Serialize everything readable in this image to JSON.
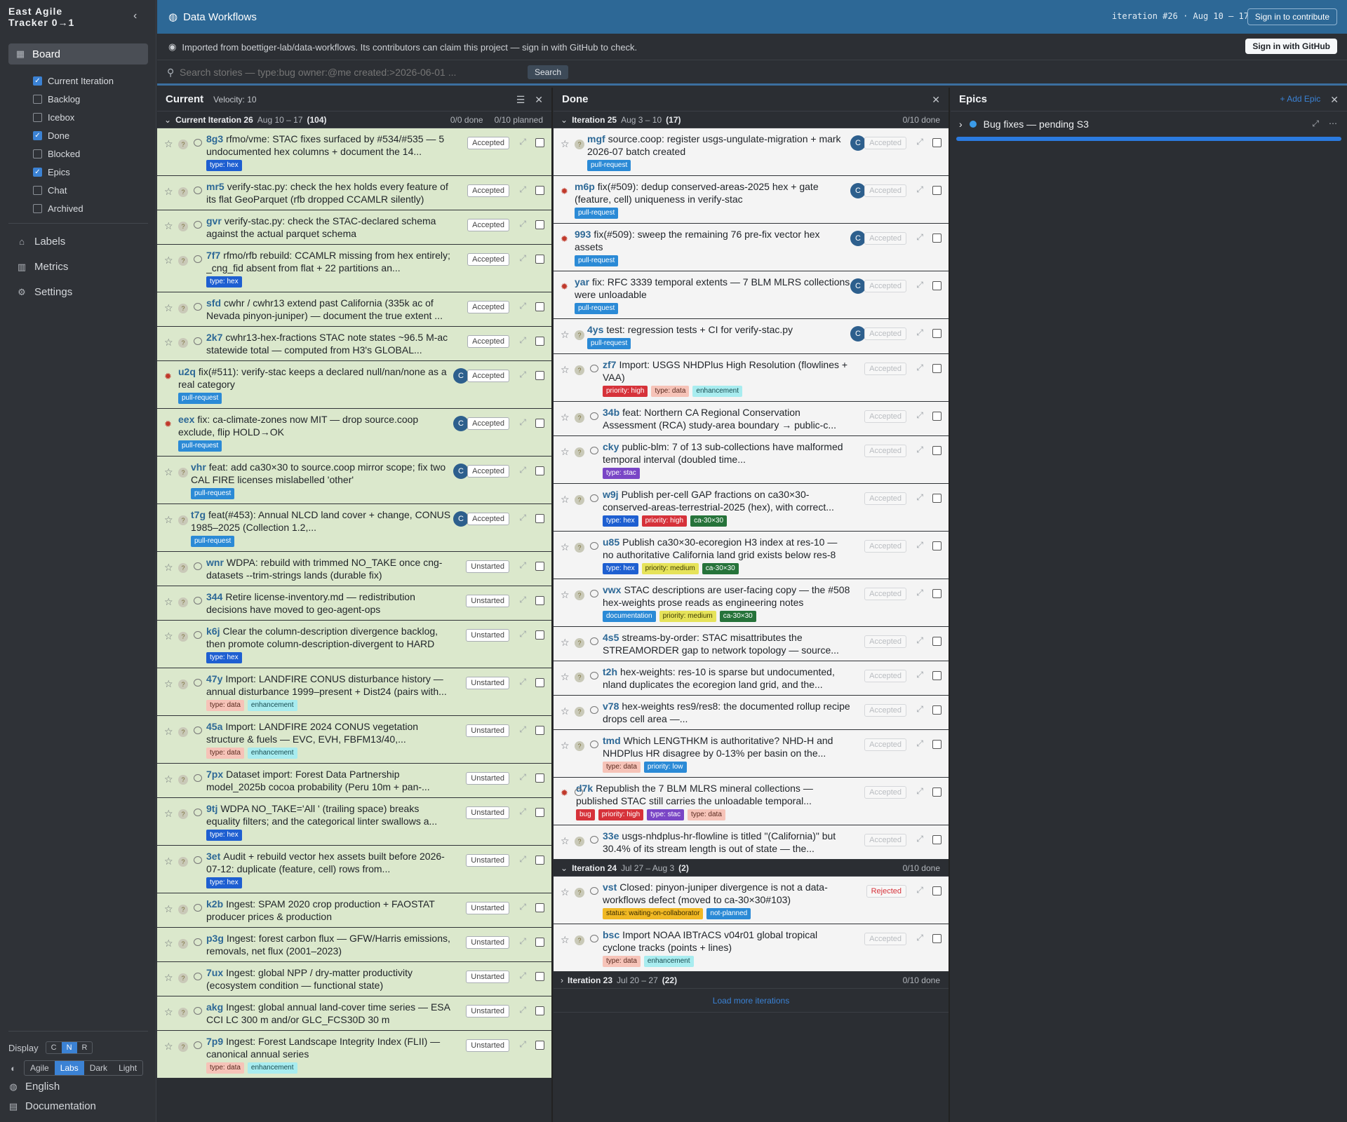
{
  "sidebar": {
    "brand_line1": "East Agile",
    "brand_line2": "Tracker 0→1",
    "board_label": "Board",
    "panels": [
      {
        "label": "Current Iteration",
        "checked": true
      },
      {
        "label": "Backlog",
        "checked": false
      },
      {
        "label": "Icebox",
        "checked": false
      },
      {
        "label": "Done",
        "checked": true
      },
      {
        "label": "Blocked",
        "checked": false
      },
      {
        "label": "Epics",
        "checked": true
      },
      {
        "label": "Chat",
        "checked": false
      },
      {
        "label": "Archived",
        "checked": false
      }
    ],
    "labels": "Labels",
    "metrics": "Metrics",
    "settings": "Settings",
    "display_label": "Display",
    "display_options": [
      "C",
      "N",
      "R"
    ],
    "theme_options": [
      "Agile",
      "Labs",
      "Dark",
      "Light"
    ],
    "language": "English",
    "documentation": "Documentation"
  },
  "header": {
    "title": "Data Workflows",
    "iteration_info": "iteration #26 · Aug 10 – 17",
    "sign_in": "Sign in to contribute"
  },
  "banner": {
    "message": "Imported from boettiger-lab/data-workflows. Its contributors can claim this project — sign in with GitHub to check.",
    "button": "Sign in with GitHub"
  },
  "search": {
    "placeholder": "Search stories — type:bug owner:@me created:>2026-06-01 ...",
    "button": "Search"
  },
  "current": {
    "title": "Current",
    "velocity": "Velocity: 10",
    "iteration": {
      "name": "Current Iteration 26",
      "dates": "Aug 10 – 17",
      "count": "(104)",
      "done": "0/0 done",
      "planned": "0/10 planned"
    },
    "stories": [
      {
        "id": "8g3",
        "text": "rfmo/vme: STAC fixes surfaced by #534/#535 — 5 undocumented hex columns + document the 14...",
        "labels": [
          [
            "type: hex",
            "hex"
          ]
        ],
        "state": "Accepted"
      },
      {
        "id": "mr5",
        "text": "verify-stac.py: check the hex holds every feature of its flat GeoParquet (rfb dropped CCAMLR silently)",
        "labels": [],
        "state": "Accepted"
      },
      {
        "id": "gvr",
        "text": "verify-stac.py: check the STAC-declared schema against the actual parquet schema",
        "labels": [],
        "state": "Accepted"
      },
      {
        "id": "7f7",
        "text": "rfmo/rfb rebuild: CCAMLR missing from hex entirely; _cng_fid absent from flat + 22 partitions an...",
        "labels": [
          [
            "type: hex",
            "hex"
          ]
        ],
        "state": "Accepted"
      },
      {
        "id": "sfd",
        "text": "cwhr / cwhr13 extend past California (335k ac of Nevada pinyon-juniper) — document the true extent ...",
        "labels": [],
        "state": "Accepted"
      },
      {
        "id": "2k7",
        "text": "cwhr13-hex-fractions STAC note states ~96.5 M-ac statewide total — computed from H3's GLOBAL...",
        "labels": [],
        "state": "Accepted"
      },
      {
        "id": "u2q",
        "text": "fix(#511): verify-stac keeps a declared null/nan/none as a real category",
        "labels": [
          [
            "pull-request",
            "pr"
          ]
        ],
        "state": "Accepted",
        "bug": true,
        "owner": "C"
      },
      {
        "id": "eex",
        "text": "fix: ca-climate-zones now MIT — drop source.coop exclude, flip HOLD→OK",
        "labels": [
          [
            "pull-request",
            "pr"
          ]
        ],
        "state": "Accepted",
        "bug": true,
        "owner": "C"
      },
      {
        "id": "vhr",
        "text": "feat: add ca30×30 to source.coop mirror scope; fix two CAL FIRE licenses mislabelled 'other'",
        "labels": [
          [
            "pull-request",
            "pr"
          ]
        ],
        "state": "Accepted",
        "owner": "C"
      },
      {
        "id": "t7g",
        "text": "feat(#453): Annual NLCD land cover + change, CONUS 1985–2025 (Collection 1.2,...",
        "labels": [
          [
            "pull-request",
            "pr"
          ]
        ],
        "state": "Accepted",
        "owner": "C"
      },
      {
        "id": "wnr",
        "text": "WDPA: rebuild with trimmed NO_TAKE once cng-datasets --trim-strings lands (durable fix)",
        "labels": [],
        "state": "Unstarted"
      },
      {
        "id": "344",
        "text": "Retire license-inventory.md — redistribution decisions have moved to geo-agent-ops",
        "labels": [],
        "state": "Unstarted"
      },
      {
        "id": "k6j",
        "text": "Clear the column-description divergence backlog, then promote column-description-divergent to HARD",
        "labels": [
          [
            "type: hex",
            "hex"
          ]
        ],
        "state": "Unstarted"
      },
      {
        "id": "47y",
        "text": "Import: LANDFIRE CONUS disturbance history — annual disturbance 1999–present + Dist24 (pairs with...",
        "labels": [
          [
            "type: data",
            "data"
          ],
          [
            "enhancement",
            "enh"
          ]
        ],
        "state": "Unstarted"
      },
      {
        "id": "45a",
        "text": "Import: LANDFIRE 2024 CONUS vegetation structure & fuels — EVC, EVH, FBFM13/40,...",
        "labels": [
          [
            "type: data",
            "data"
          ],
          [
            "enhancement",
            "enh"
          ]
        ],
        "state": "Unstarted"
      },
      {
        "id": "7px",
        "text": "Dataset import: Forest Data Partnership model_2025b cocoa probability (Peru 10m + pan-...",
        "labels": [],
        "state": "Unstarted"
      },
      {
        "id": "9tj",
        "text": "WDPA NO_TAKE='All ' (trailing space) breaks equality filters; and the categorical linter swallows a...",
        "labels": [
          [
            "type: hex",
            "hex"
          ]
        ],
        "state": "Unstarted"
      },
      {
        "id": "3et",
        "text": "Audit + rebuild vector hex assets built before 2026-07-12: duplicate (feature, cell) rows from...",
        "labels": [
          [
            "type: hex",
            "hex"
          ]
        ],
        "state": "Unstarted"
      },
      {
        "id": "k2b",
        "text": "Ingest: SPAM 2020 crop production + FAOSTAT producer prices & production",
        "labels": [],
        "state": "Unstarted"
      },
      {
        "id": "p3g",
        "text": "Ingest: forest carbon flux — GFW/Harris emissions, removals, net flux (2001–2023)",
        "labels": [],
        "state": "Unstarted"
      },
      {
        "id": "7ux",
        "text": "Ingest: global NPP / dry-matter productivity (ecosystem condition — functional state)",
        "labels": [],
        "state": "Unstarted"
      },
      {
        "id": "akg",
        "text": "Ingest: global annual land-cover time series — ESA CCI LC 300 m and/or GLC_FCS30D 30 m",
        "labels": [],
        "state": "Unstarted"
      },
      {
        "id": "7p9",
        "text": "Ingest: Forest Landscape Integrity Index (FLII) — canonical annual series",
        "labels": [
          [
            "type: data",
            "data"
          ],
          [
            "enhancement",
            "enh"
          ]
        ],
        "state": "Unstarted"
      }
    ]
  },
  "done": {
    "title": "Done",
    "iterations": [
      {
        "name": "Iteration 25",
        "dates": "Aug 3 – 10",
        "count": "(17)",
        "done": "0/10 done",
        "expanded": true,
        "stories": [
          {
            "id": "mgf",
            "text": "source.coop: register usgs-ungulate-migration + mark 2026-07 batch created",
            "labels": [
              [
                "pull-request",
                "pr"
              ]
            ],
            "state": "Accepted",
            "owner": "C"
          },
          {
            "id": "m6p",
            "text": "fix(#509): dedup conserved-areas-2025 hex + gate (feature, cell) uniqueness in verify-stac",
            "labels": [
              [
                "pull-request",
                "pr"
              ]
            ],
            "state": "Accepted",
            "owner": "C",
            "bug": true
          },
          {
            "id": "993",
            "text": "fix(#509): sweep the remaining 76 pre-fix vector hex assets",
            "labels": [
              [
                "pull-request",
                "pr"
              ]
            ],
            "state": "Accepted",
            "owner": "C",
            "bug": true
          },
          {
            "id": "yar",
            "text": "fix: RFC 3339 temporal extents — 7 BLM MLRS collections were unloadable",
            "labels": [
              [
                "pull-request",
                "pr"
              ]
            ],
            "state": "Accepted",
            "owner": "C",
            "bug": true
          },
          {
            "id": "4ys",
            "text": "test: regression tests + CI for verify-stac.py",
            "labels": [
              [
                "pull-request",
                "pr"
              ]
            ],
            "state": "Accepted",
            "owner": "C"
          },
          {
            "id": "zf7",
            "text": "Import: USGS NHDPlus High Resolution (flowlines + VAA)",
            "labels": [
              [
                "priority: high",
                "high"
              ],
              [
                "type: data",
                "data"
              ],
              [
                "enhancement",
                "enh"
              ]
            ],
            "state": "Accepted"
          },
          {
            "id": "34b",
            "text": "feat: Northern CA Regional Conservation Assessment (RCA) study-area boundary → public-c...",
            "labels": [],
            "state": "Accepted"
          },
          {
            "id": "cky",
            "text": "public-blm: 7 of 13 sub-collections have malformed temporal interval (doubled time...",
            "labels": [
              [
                "type: stac",
                "stac"
              ]
            ],
            "state": "Accepted"
          },
          {
            "id": "w9j",
            "text": "Publish per-cell GAP fractions on ca30×30-conserved-areas-terrestrial-2025 (hex), with correct...",
            "labels": [
              [
                "type: hex",
                "hex"
              ],
              [
                "priority: high",
                "high"
              ],
              [
                "ca-30×30",
                "ca"
              ]
            ],
            "state": "Accepted"
          },
          {
            "id": "u85",
            "text": "Publish ca30×30-ecoregion H3 index at res-10 — no authoritative California land grid exists below res-8",
            "labels": [
              [
                "type: hex",
                "hex"
              ],
              [
                "priority: medium",
                "med"
              ],
              [
                "ca-30×30",
                "ca"
              ]
            ],
            "state": "Accepted"
          },
          {
            "id": "vwx",
            "text": "STAC descriptions are user-facing copy — the #508 hex-weights prose reads as engineering notes",
            "labels": [
              [
                "documentation",
                "doc"
              ],
              [
                "priority: medium",
                "med"
              ],
              [
                "ca-30×30",
                "ca"
              ]
            ],
            "state": "Accepted"
          },
          {
            "id": "4s5",
            "text": "streams-by-order: STAC misattributes the STREAMORDER gap to network topology — source...",
            "labels": [],
            "state": "Accepted"
          },
          {
            "id": "t2h",
            "text": "hex-weights: res-10 is sparse but undocumented, nland duplicates the ecoregion land grid, and the...",
            "labels": [],
            "state": "Accepted"
          },
          {
            "id": "v78",
            "text": "hex-weights res9/res8: the documented rollup recipe drops cell area —...",
            "labels": [],
            "state": "Accepted"
          },
          {
            "id": "tmd",
            "text": "Which LENGTHKM is authoritative? NHD-H and NHDPlus HR disagree by 0-13% per basin on the...",
            "labels": [
              [
                "type: data",
                "data"
              ],
              [
                "priority: low",
                "low"
              ]
            ],
            "state": "Accepted"
          },
          {
            "id": "d7k",
            "text": "Republish the 7 BLM MLRS mineral collections — published STAC still carries the unloadable temporal...",
            "labels": [
              [
                "bug",
                "bug"
              ],
              [
                "priority: high",
                "high"
              ],
              [
                "type: stac",
                "stac"
              ],
              [
                "type: data",
                "data"
              ]
            ],
            "state": "Accepted",
            "bug": true
          },
          {
            "id": "33e",
            "text": "usgs-nhdplus-hr-flowline is titled \"(California)\" but 30.4% of its stream length is out of state — the...",
            "labels": [],
            "state": "Accepted"
          }
        ]
      },
      {
        "name": "Iteration 24",
        "dates": "Jul 27 – Aug 3",
        "count": "(2)",
        "done": "0/10 done",
        "expanded": true,
        "stories": [
          {
            "id": "vst",
            "text": "Closed: pinyon-juniper divergence is not a data-workflows defect (moved to ca-30×30#103)",
            "labels": [
              [
                "status: waiting-on-collaborator",
                "wait"
              ],
              [
                "not-planned",
                "np"
              ]
            ],
            "state": "Rejected"
          },
          {
            "id": "bsc",
            "text": "Import NOAA IBTrACS v04r01 global tropical cyclone tracks (points + lines)",
            "labels": [
              [
                "type: data",
                "data"
              ],
              [
                "enhancement",
                "enh"
              ]
            ],
            "state": "Accepted"
          }
        ]
      },
      {
        "name": "Iteration 23",
        "dates": "Jul 20 – 27",
        "count": "(22)",
        "done": "0/10 done",
        "expanded": false,
        "stories": []
      }
    ],
    "load_more": "Load more iterations"
  },
  "epics": {
    "title": "Epics",
    "add": "+ Add Epic",
    "items": [
      {
        "name": "Bug fixes — pending S3",
        "progress": 1.0
      }
    ]
  },
  "colors": {
    "header": "#2d6896",
    "accent": "#3b82d4",
    "current_bg": "#dbe8cc"
  }
}
